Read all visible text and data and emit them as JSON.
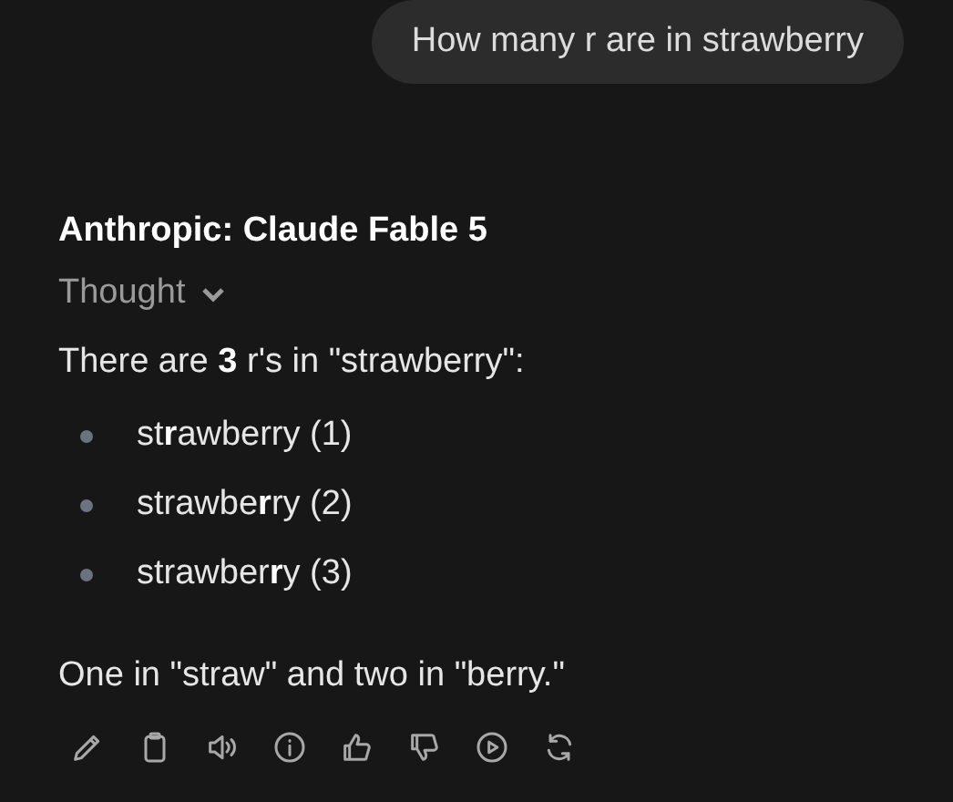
{
  "user_message": {
    "text": "How many r are in strawberry"
  },
  "response": {
    "model_name": "Anthropic: Claude Fable 5",
    "thought": {
      "label": "Thought",
      "expanded": false
    },
    "intro": "There are **3** r's in \"strawberry\":",
    "list": [
      {
        "text": "st**r**awberry (1)"
      },
      {
        "text": "strawbe**r**ry (2)"
      },
      {
        "text": "strawber**r**y (3)"
      }
    ],
    "outro": "One in \"straw\" and two in \"berry.\"",
    "actions": [
      {
        "kind": "edit"
      },
      {
        "kind": "copy"
      },
      {
        "kind": "speak"
      },
      {
        "kind": "info"
      },
      {
        "kind": "like"
      },
      {
        "kind": "dislike"
      },
      {
        "kind": "play"
      },
      {
        "kind": "regenerate"
      }
    ]
  }
}
